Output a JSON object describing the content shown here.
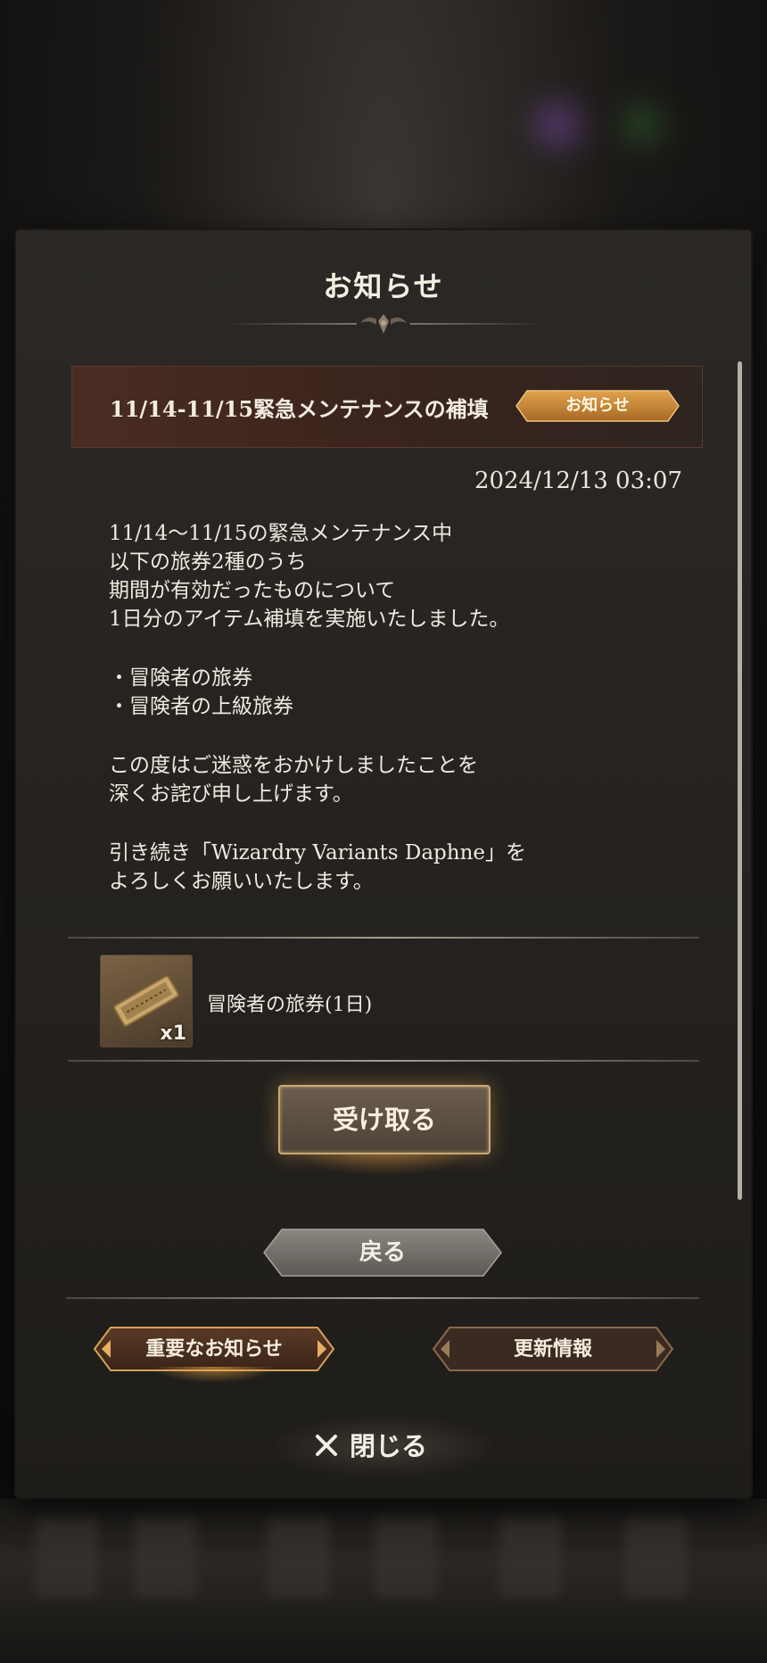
{
  "dialog": {
    "title": "お知らせ"
  },
  "notice": {
    "title": "11/14-11/15緊急メンテナンスの補填",
    "badge": "お知らせ",
    "timestamp": "2024/12/13 03:07",
    "body": [
      "11/14～11/15の緊急メンテナンス中",
      "以下の旅券2種のうち",
      "期間が有効だったものについて",
      "1日分のアイテム補填を実施いたしました。",
      "",
      "・冒険者の旅券",
      "・冒険者の上級旅券",
      "",
      "この度はご迷惑をおかけしましたことを",
      "深くお詫び申し上げます。",
      "",
      "引き続き「Wizardry Variants Daphne」を",
      "よろしくお願いいたします。"
    ]
  },
  "reward": {
    "name": "冒険者の旅券(1日)",
    "quantity": "x1",
    "icon": "ticket-icon"
  },
  "buttons": {
    "receive": "受け取る",
    "back": "戻る",
    "important_notices": "重要なお知らせ",
    "update_info": "更新情報",
    "close": "閉じる"
  },
  "colors": {
    "accent_gold": "#c98a3a",
    "header_bg": "#4a2c22",
    "panel_bg": "#2b2825"
  }
}
